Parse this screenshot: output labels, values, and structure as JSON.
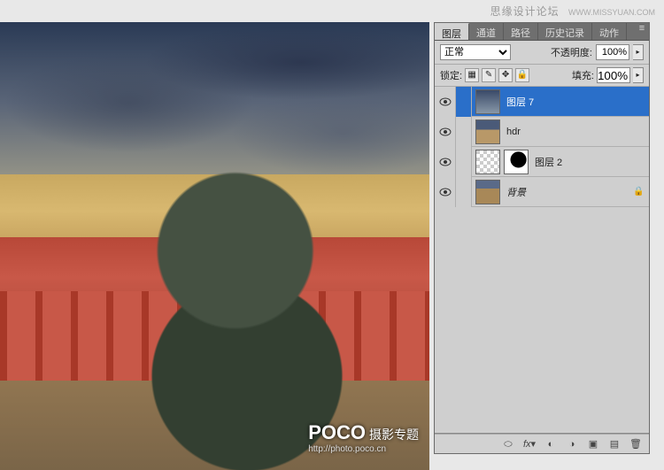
{
  "watermark": {
    "text": "思缘设计论坛",
    "url": "WWW.MISSYUAN.COM"
  },
  "canvas_overlay": {
    "brand": "POCO",
    "subject": "摄影专题",
    "url": "http://photo.poco.cn"
  },
  "panel": {
    "tabs": [
      "图层",
      "通道",
      "路径",
      "历史记录",
      "动作"
    ],
    "active_tab": 0,
    "blend_mode": "正常",
    "opacity_label": "不透明度:",
    "opacity_value": "100%",
    "lock_label": "锁定:",
    "fill_label": "填充:",
    "fill_value": "100%"
  },
  "layers": [
    {
      "name": "图层 7",
      "visible": true,
      "selected": true,
      "thumb": "sky",
      "mask": false,
      "locked": false
    },
    {
      "name": "hdr",
      "visible": true,
      "selected": false,
      "thumb": "hdr",
      "mask": false,
      "locked": false
    },
    {
      "name": "图层 2",
      "visible": true,
      "selected": false,
      "thumb": "checker",
      "mask": true,
      "locked": false
    },
    {
      "name": "背景",
      "visible": true,
      "selected": false,
      "thumb": "bg",
      "mask": false,
      "locked": true
    }
  ],
  "footer_icons": [
    "link-icon",
    "fx-icon",
    "mask-icon",
    "adjust-icon",
    "group-icon",
    "new-icon",
    "trash-icon"
  ]
}
